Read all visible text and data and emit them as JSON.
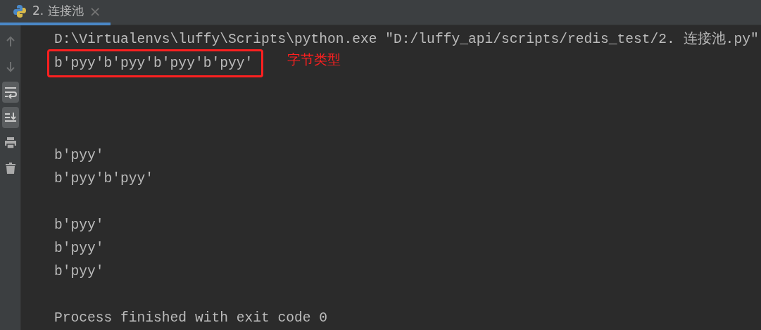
{
  "tabs": [
    {
      "label": "2. 连接池",
      "selected": true,
      "close": "×"
    }
  ],
  "toolbar": [
    {
      "kind": "up",
      "disabled": true,
      "on": false
    },
    {
      "kind": "down",
      "disabled": true,
      "on": false
    },
    {
      "kind": "wrap",
      "disabled": false,
      "on": true
    },
    {
      "kind": "scroll-end",
      "disabled": false,
      "on": true
    },
    {
      "kind": "print",
      "disabled": false,
      "on": false
    },
    {
      "kind": "trash",
      "disabled": false,
      "on": false
    }
  ],
  "console": [
    {
      "kind": "text",
      "text": "D:\\Virtualenvs\\luffy\\Scripts\\python.exe \"D:/luffy_api/scripts/redis_test/2. 连接池.py\"",
      "highlighted": false
    },
    {
      "kind": "text",
      "text": "b'pyy'b'pyy'b'pyy'b'pyy'",
      "highlighted": true,
      "annotation": "字节类型"
    },
    {
      "kind": "blank"
    },
    {
      "kind": "blank"
    },
    {
      "kind": "blank"
    },
    {
      "kind": "text",
      "text": "b'pyy'",
      "highlighted": false
    },
    {
      "kind": "text",
      "text": "b'pyy'b'pyy'",
      "highlighted": false
    },
    {
      "kind": "blank"
    },
    {
      "kind": "text",
      "text": "b'pyy'",
      "highlighted": false
    },
    {
      "kind": "text",
      "text": "b'pyy'",
      "highlighted": false
    },
    {
      "kind": "text",
      "text": "b'pyy'",
      "highlighted": false
    },
    {
      "kind": "blank"
    },
    {
      "kind": "text",
      "text": "Process finished with exit code 0",
      "highlighted": false
    }
  ]
}
